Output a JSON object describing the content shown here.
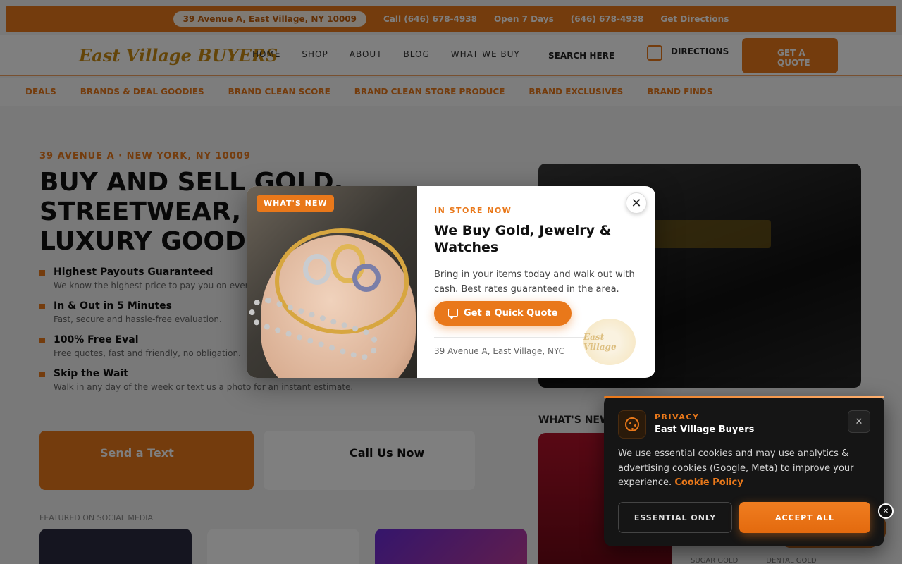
{
  "background": {
    "topbar": {
      "pill": "39 Avenue A, East Village, NY 10009",
      "items": [
        "Call (646) 678-4938",
        "Open 7 Days",
        "(646) 678-4938",
        "Get Directions"
      ]
    },
    "logo": "East Village BUYERS",
    "nav": [
      "HOME",
      "SHOP",
      "ABOUT",
      "BLOG",
      "WHAT WE BUY"
    ],
    "search_label": "SEARCH HERE",
    "header_link": "DIRECTIONS",
    "header_button": "GET A QUOTE",
    "categories": [
      "DEALS",
      "BRANDS & DEAL GOODIES",
      "BRAND CLEAN SCORE",
      "BRAND CLEAN STORE PRODUCE",
      "BRAND EXCLUSIVES",
      "BRAND FINDS"
    ],
    "hero_kicker": "39 AVENUE A · NEW YORK, NY 10009",
    "hero_title": "BUY AND SELL GOLD, STREETWEAR, LUXURY GOODS",
    "hero_points": [
      {
        "title": "Highest Payouts Guaranteed",
        "sub": "We know the highest price to pay you on every item."
      },
      {
        "title": "In & Out in 5 Minutes",
        "sub": "Fast, secure and hassle-free evaluation."
      },
      {
        "title": "100% Free Eval",
        "sub": "Free quotes, fast and friendly, no obligation."
      },
      {
        "title": "Skip the Wait",
        "sub": "Walk in any day of the week or text us a photo for an instant estimate."
      }
    ],
    "cta_text": "Send a Text",
    "cta_call": "Call Us Now",
    "whats_new_heading": "WHAT'S NEW",
    "featured_label": "FEATURED ON SOCIAL MEDIA",
    "under_cookie": [
      "SUGAR GOLD",
      "DENTAL GOLD"
    ]
  },
  "modal": {
    "badge": "WHAT'S NEW",
    "kicker": "IN STORE NOW",
    "title": "We Buy Gold, Jewelry & Watches",
    "description": "Bring in your items today and walk out with cash. Best rates guaranteed in the area.",
    "button_label": "Get a Quick Quote",
    "address": "39 Avenue A, East Village, NYC",
    "seal_text": "East Village"
  },
  "cookie": {
    "kicker": "PRIVACY",
    "title": "East Village Buyers",
    "text": "We use essential cookies and may use analytics & advertising cookies (Google, Meta) to improve your experience.",
    "link": "Cookie Policy",
    "essential_label": "ESSENTIAL ONLY",
    "accept_label": "ACCEPT ALL",
    "close_symbol": "✕"
  },
  "colors": {
    "accent": "#e9781a",
    "dark_panel": "#151515"
  }
}
